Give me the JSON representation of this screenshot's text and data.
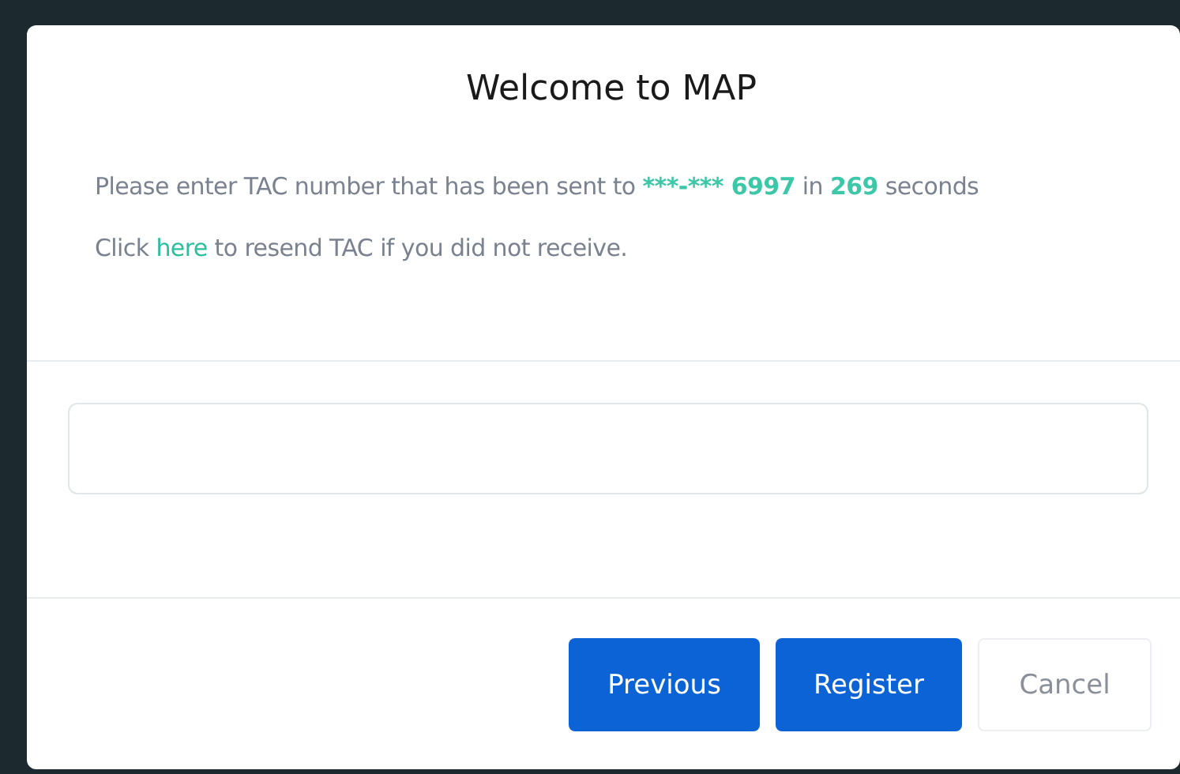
{
  "dialog": {
    "title": "Welcome to MAP",
    "message": [
      {
        "kind": "text",
        "text": "Please enter TAC number that has been sent to "
      },
      {
        "kind": "highlight",
        "text": "***-*** 6997"
      },
      {
        "kind": "text",
        "text": " in "
      },
      {
        "kind": "highlight",
        "text": "269"
      },
      {
        "kind": "text",
        "text": " seconds"
      }
    ],
    "resend": [
      {
        "kind": "text",
        "text": "Click "
      },
      {
        "kind": "link",
        "text": "here"
      },
      {
        "kind": "text",
        "text": " to resend TAC if you did not receive."
      }
    ],
    "buttons": [
      {
        "label": "Previous",
        "kind": "primary"
      },
      {
        "label": "Register",
        "kind": "primary"
      },
      {
        "label": "Cancel",
        "kind": "secondary"
      }
    ]
  }
}
